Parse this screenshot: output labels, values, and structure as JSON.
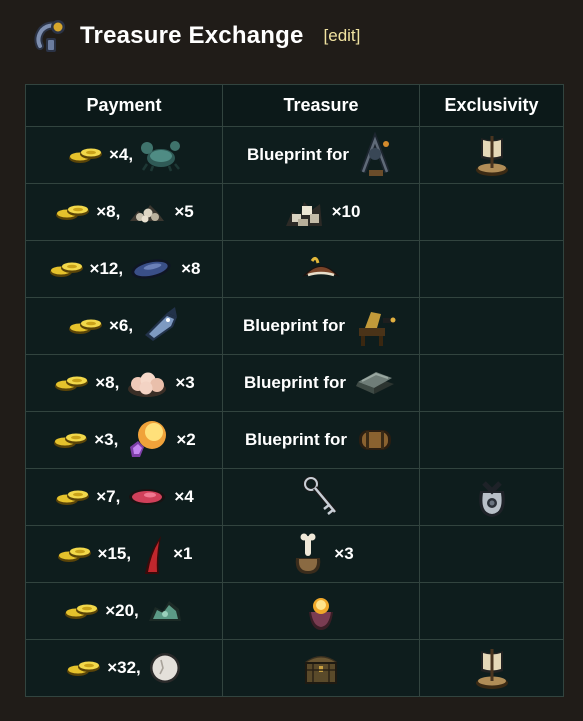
{
  "page": {
    "title": "Treasure Exchange",
    "edit_label": "[edit]",
    "header_icon": "hook-key-icon"
  },
  "table": {
    "headers": [
      "Payment",
      "Treasure",
      "Exclusivity"
    ],
    "rows": [
      {
        "payment": [
          {
            "icon": "gold-coins-icon",
            "qty": "×4,"
          },
          {
            "icon": "crab-icon",
            "qty": ""
          }
        ],
        "treasure": {
          "text": "Blueprint for",
          "icon": "crafting-station-icon",
          "qty": ""
        },
        "exclusivity": "sail-boat-icon"
      },
      {
        "payment": [
          {
            "icon": "gold-coins-icon",
            "qty": "×8,"
          },
          {
            "icon": "rock-pile-icon",
            "qty": "×5"
          }
        ],
        "treasure": {
          "text": "",
          "icon": "rocks-icon",
          "qty": "×10"
        },
        "exclusivity": ""
      },
      {
        "payment": [
          {
            "icon": "gold-coins-icon",
            "qty": "×12,"
          },
          {
            "icon": "mussel-icon",
            "qty": "×8"
          }
        ],
        "treasure": {
          "text": "",
          "icon": "pirate-hat-icon",
          "qty": ""
        },
        "exclusivity": ""
      },
      {
        "payment": [
          {
            "icon": "gold-coins-icon",
            "qty": "×6,"
          },
          {
            "icon": "fish-icon",
            "qty": ""
          }
        ],
        "treasure": {
          "text": "Blueprint for",
          "icon": "cannon-station-icon",
          "qty": ""
        },
        "exclusivity": ""
      },
      {
        "payment": [
          {
            "icon": "gold-coins-icon",
            "qty": "×8,"
          },
          {
            "icon": "pearls-icon",
            "qty": "×3"
          }
        ],
        "treasure": {
          "text": "Blueprint for",
          "icon": "stone-slab-icon",
          "qty": ""
        },
        "exclusivity": ""
      },
      {
        "payment": [
          {
            "icon": "gold-coins-icon",
            "qty": "×3,"
          },
          {
            "icon": "gem-cluster-icon",
            "qty": "×2"
          }
        ],
        "treasure": {
          "text": "Blueprint for",
          "icon": "barrel-icon",
          "qty": ""
        },
        "exclusivity": ""
      },
      {
        "payment": [
          {
            "icon": "gold-coins-icon",
            "qty": "×7,"
          },
          {
            "icon": "red-shell-icon",
            "qty": "×4"
          }
        ],
        "treasure": {
          "text": "",
          "icon": "key-icon",
          "qty": ""
        },
        "exclusivity": "merchant-sack-icon"
      },
      {
        "payment": [
          {
            "icon": "gold-coins-icon",
            "qty": "×15,"
          },
          {
            "icon": "red-fin-icon",
            "qty": "×1"
          }
        ],
        "treasure": {
          "text": "",
          "icon": "bone-sack-icon",
          "qty": "×3"
        },
        "exclusivity": ""
      },
      {
        "payment": [
          {
            "icon": "gold-coins-icon",
            "qty": "×20,"
          },
          {
            "icon": "green-ore-icon",
            "qty": ""
          }
        ],
        "treasure": {
          "text": "",
          "icon": "glowing-orb-icon",
          "qty": ""
        },
        "exclusivity": ""
      },
      {
        "payment": [
          {
            "icon": "gold-coins-icon",
            "qty": "×32,"
          },
          {
            "icon": "white-egg-icon",
            "qty": ""
          }
        ],
        "treasure": {
          "text": "",
          "icon": "treasure-chest-icon",
          "qty": ""
        },
        "exclusivity": "sail-boat-icon"
      }
    ]
  }
}
